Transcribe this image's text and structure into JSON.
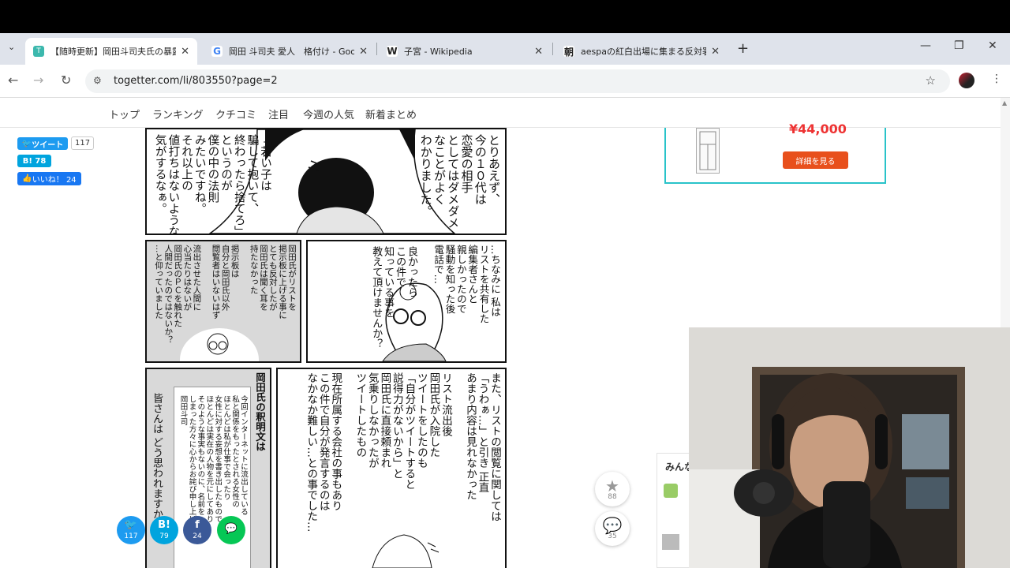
{
  "browser": {
    "tabs": [
      {
        "title": "【随時更新】岡田斗司夫氏の暴露",
        "favicon": "T",
        "active": true
      },
      {
        "title": "岡田 斗司夫 愛人　格付け - Goo",
        "favicon": "G",
        "active": false
      },
      {
        "title": "子宮 - Wikipedia",
        "favicon": "W",
        "active": false
      },
      {
        "title": "aespaの紅白出場に集まる反対署",
        "favicon": "朝",
        "active": false
      }
    ],
    "new_tab": "+",
    "url": "togetter.com/li/803550?page=2"
  },
  "site_nav": [
    "トップ",
    "ランキング",
    "クチコミ",
    "注目",
    "今週の人気",
    "新着まとめ"
  ],
  "social": {
    "tweet_label": "ツイート",
    "tweet_count": "117",
    "hatena_label": "B! 78",
    "like_label": "いいね！ 24"
  },
  "ad": {
    "price": "¥44,000",
    "button": "詳細を見る"
  },
  "manga": {
    "p1_right": "とりあえず、\n今の１０代は\n恋愛の相手\nとしてはダメダメ\nなことがよく\nわかりました。",
    "p1_left": "「若い子は\n騙して抱いて、\n終わったら捨てろ」\nというのが\n僕の中の法則\nみたいですね。\nそれ以上の\n値打ちはないような\n気がするなぁ。",
    "p2_right": "…ちなみに 私は\nリストを共有した\n編集者さんと\n親しかったので\n騒動を知った後\n電話で…",
    "p2_mid": "良かったら\nこの件で\n知っている事を\n教えて頂けませんか？",
    "p2_left": "岡田氏がリストを\n掲示板に上げる事に\nとても反対したが\n岡田氏は聞く耳を\n持たなかった\n\n掲示板は\n自分と岡田氏以外\n閲覧者はいないはず\n\n流出させた人間に\n心当たりはないが\n岡田氏のＰＣを触れた\n人間だったのではないか？\n…と仰っていました",
    "p3_right": "また、リストの閲覧に関しては\n「うわぁ…」と引き 正直\nあまり内容は見れなかった\n\nリスト流出後\n岡田氏が入院した\nツイートをしたのも\n「自分がツイートすると\n説得力がないから」と\n岡田氏に直接頼まれ\n気乗りしなかったが\nツイートしたもの\n\n現在所属する会社の事もあり\nこの件で自分が発言するのは\nなかなか難しい…との事でした…",
    "p3_title": "岡田氏の釈明文は",
    "p3_doc": "今回インターネットに流出している\n私と関係をもったとされる女性の\nほとんどは私が仕事で会ったり\n女性に対する妄想を書き出したもので\nほとんどは実在の人物を元にしてあり\nそのような事実もないのに、名前を\nしまった方々に心からお詫び申し上げます\n岡田斗司",
    "p3_left": "皆さんは どう思われますか…？"
  },
  "share_bar": [
    {
      "icon": "twitter-icon",
      "glyph": "🐦",
      "count": "117",
      "color": "#1d9bf0"
    },
    {
      "icon": "hatena-icon",
      "glyph": "B!",
      "count": "79",
      "color": "#00a4de"
    },
    {
      "icon": "facebook-icon",
      "glyph": "f",
      "count": "24",
      "color": "#3b5998"
    },
    {
      "icon": "line-icon",
      "glyph": "💬",
      "count": "",
      "color": "#06c755"
    }
  ],
  "floating": {
    "favorite_count": "88",
    "comment_count": "35"
  },
  "sidebar_widget_title": "みんな"
}
